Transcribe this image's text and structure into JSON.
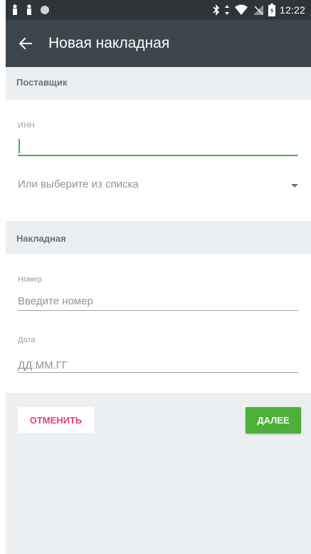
{
  "status_bar": {
    "time": "12:22",
    "icons": [
      "notification-icon",
      "notification-icon",
      "circle-icon",
      "bluetooth-icon",
      "data-arrows-icon",
      "wifi-icon",
      "no-sim-icon",
      "battery-icon"
    ]
  },
  "app_bar": {
    "back_icon": "arrow-left-icon",
    "title": "Новая накладная"
  },
  "supplier_section": {
    "header": "Поставщик",
    "inn_label": "ИНН",
    "inn_value": "",
    "select_placeholder": "Или выберите из списка"
  },
  "invoice_section": {
    "header": "Накладная",
    "number_label": "Номер",
    "number_placeholder": "Введите номер",
    "date_label": "Дата",
    "date_placeholder": "ДД.ММ.ГГ"
  },
  "actions": {
    "cancel_label": "ОТМЕНИТЬ",
    "next_label": "ДАЛЕЕ"
  },
  "colors": {
    "status_bar": "#2e3438",
    "app_bar": "#3c474d",
    "background": "#eceff2",
    "accent_green": "#4caf37",
    "cancel_pink": "#e0427a"
  }
}
